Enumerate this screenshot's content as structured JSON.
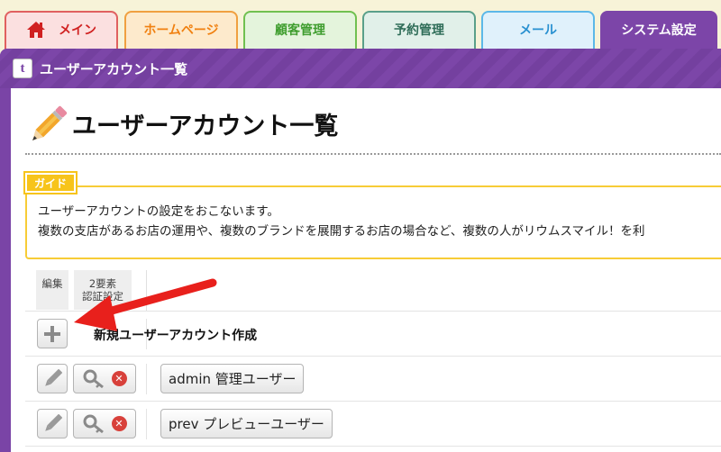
{
  "tabs": [
    {
      "label": "メイン",
      "icon": "home-icon"
    },
    {
      "label": "ホームページ"
    },
    {
      "label": "顧客管理"
    },
    {
      "label": "予約管理"
    },
    {
      "label": "メール"
    },
    {
      "label": "システム設定",
      "active": true
    }
  ],
  "window": {
    "title_icon_letter": "t",
    "title": "ユーザーアカウント一覧"
  },
  "page": {
    "title": "ユーザーアカウント一覧"
  },
  "guide": {
    "badge": "ガイド",
    "line1": "ユーザーアカウントの設定をおこないます。",
    "line2": "複数の支店があるお店の運用や、複数のブランドを展開するお店の場合など、複数の人がリウムスマイル！を利"
  },
  "table": {
    "header_edit": "編集",
    "header_2fa_line1": "2要素",
    "header_2fa_line2": "認証設定",
    "new_account_label": "新規ユーザーアカウント作成",
    "accounts": [
      {
        "label": "admin 管理ユーザー"
      },
      {
        "label": "prev プレビューユーザー"
      }
    ]
  },
  "colors": {
    "accent_purple": "#7a44a6",
    "guide_yellow": "#f7c41b",
    "delete_red": "#d8413b",
    "annotation_arrow": "#e8201c"
  }
}
